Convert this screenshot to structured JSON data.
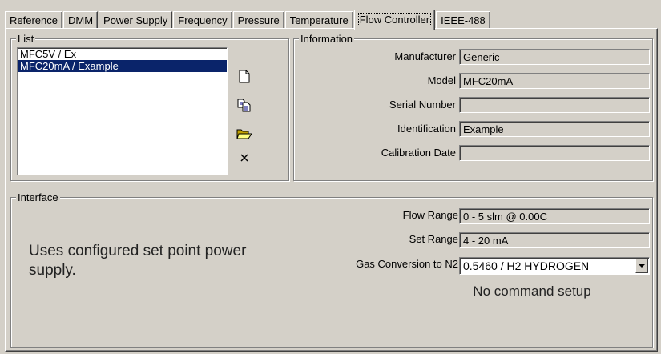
{
  "tabs": [
    {
      "label": "Reference"
    },
    {
      "label": "DMM"
    },
    {
      "label": "Power Supply"
    },
    {
      "label": "Frequency"
    },
    {
      "label": "Pressure"
    },
    {
      "label": "Temperature"
    },
    {
      "label": "Flow Controller"
    },
    {
      "label": "IEEE-488"
    }
  ],
  "active_tab": "Flow Controller",
  "list": {
    "legend": "List",
    "items": [
      {
        "label": "MFC5V  / Ex"
      },
      {
        "label": "MFC20mA  / Example"
      }
    ],
    "selected_index": 1,
    "actions": [
      "new-document-icon",
      "copy-icon",
      "open-folder-icon",
      "delete-icon"
    ]
  },
  "information": {
    "legend": "Information",
    "manufacturer_label": "Manufacturer",
    "manufacturer_value": "Generic",
    "model_label": "Model",
    "model_value": "MFC20mA",
    "serial_label": "Serial Number",
    "serial_value": "",
    "identification_label": "Identification",
    "identification_value": "Example",
    "calibration_label": "Calibration Date",
    "calibration_value": ""
  },
  "interface": {
    "legend": "Interface",
    "message": "Uses configured set point power supply.",
    "flow_range_label": "Flow Range",
    "flow_range_value": "0 -  5 slm @ 0.00C",
    "set_range_label": "Set Range",
    "set_range_value": "4 -  20 mA",
    "gas_conversion_label": "Gas Conversion to N2",
    "gas_conversion_value": "0.5460 / H2  HYDROGEN",
    "command_status": "No command setup"
  },
  "colors": {
    "face": "#d4d0c8",
    "selection": "#0a246a"
  }
}
